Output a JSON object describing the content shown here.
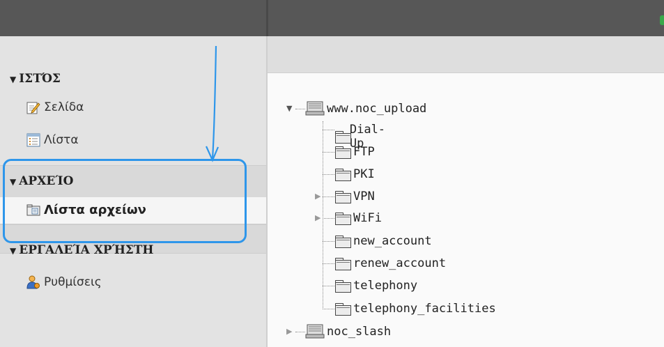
{
  "sidebar": {
    "sections": [
      {
        "title": "ΙΣΤΌΣ",
        "items": [
          "Σελίδα",
          "Λίστα"
        ]
      },
      {
        "title": "ΑΡΧΕΊΟ",
        "items": [
          "Λίστα αρχείων"
        ]
      },
      {
        "title": "ΕΡΓΑΛΕΊΑ ΧΡΉΣΤΗ",
        "items": [
          "Ρυθμίσεις"
        ]
      }
    ]
  },
  "tree": {
    "root": "www.noc_upload",
    "children": [
      "Dial-Up",
      "FTP",
      "PKI",
      "VPN",
      "WiFi",
      "new_account",
      "renew_account",
      "telephony",
      "telephony_facilities"
    ],
    "sibling": "noc_slash"
  },
  "colors": {
    "highlight": "#2e96ea",
    "topbar": "#575757"
  }
}
